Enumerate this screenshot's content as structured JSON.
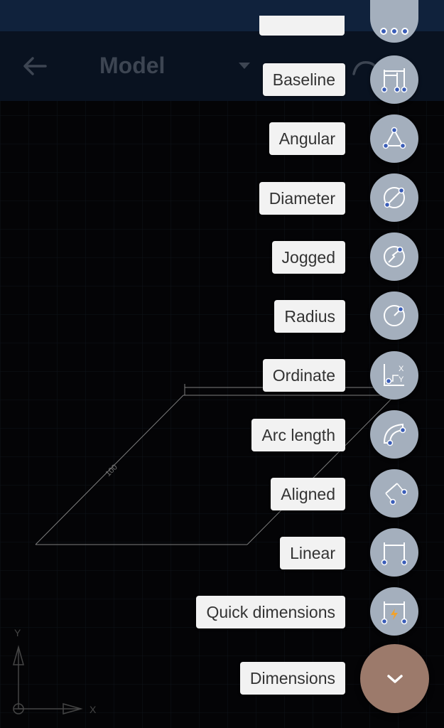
{
  "appbar": {
    "title": "Model",
    "back_icon": "arrow-left-icon",
    "dropdown_icon": "caret-down-icon",
    "redo_icon": "redo-icon"
  },
  "colors": {
    "statusbar": "#142a4a",
    "appbar": "#0b1728",
    "fab_mini": "#a4afbd",
    "fab_main": "#9c7a6b",
    "label_bg": "#f2f2f2"
  },
  "drawing": {
    "dimension_text": "100",
    "ucs_y": "Y",
    "ucs_x": "X"
  },
  "menu": {
    "items": [
      {
        "label": "Baseline",
        "icon": "baseline-dimension-icon"
      },
      {
        "label": "Angular",
        "icon": "angular-dimension-icon"
      },
      {
        "label": "Diameter",
        "icon": "diameter-dimension-icon"
      },
      {
        "label": "Jogged",
        "icon": "jogged-dimension-icon"
      },
      {
        "label": "Radius",
        "icon": "radius-dimension-icon"
      },
      {
        "label": "Ordinate",
        "icon": "ordinate-dimension-icon"
      },
      {
        "label": "Arc length",
        "icon": "arc-length-dimension-icon"
      },
      {
        "label": "Aligned",
        "icon": "aligned-dimension-icon"
      },
      {
        "label": "Linear",
        "icon": "linear-dimension-icon"
      },
      {
        "label": "Quick dimensions",
        "icon": "quick-dimension-icon"
      }
    ],
    "main_label": "Dimensions",
    "main_icon": "chevron-down-icon"
  }
}
